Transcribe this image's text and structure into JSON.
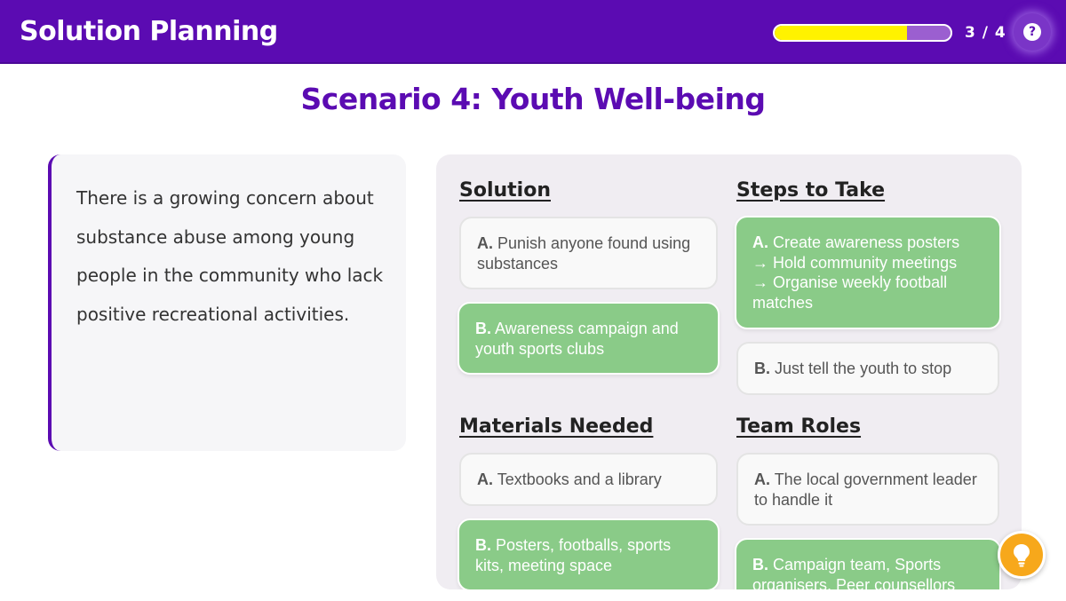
{
  "header": {
    "title": "Solution Planning",
    "progress_text": "3 / 4",
    "progress_fraction": 0.75,
    "help_icon": "question-icon",
    "accent_color": "#5b0bb2"
  },
  "scenario": {
    "title": "Scenario 4: Youth Well-being",
    "description": "There is a growing concern about substance abuse among young people in the community who lack positive recreational activities."
  },
  "sections": {
    "solution": {
      "title": "Solution",
      "options": [
        {
          "letter": "A.",
          "text": "Punish anyone found using substances",
          "selected": false
        },
        {
          "letter": "B.",
          "text": "Awareness campaign and youth sports clubs",
          "selected": true
        }
      ]
    },
    "steps": {
      "title": "Steps to Take",
      "options": [
        {
          "letter": "A.",
          "line1": "Create awareness posters",
          "line2": "→ Hold community meetings",
          "line3": "→ Organise weekly football matches",
          "selected": true
        },
        {
          "letter": "B.",
          "text": "Just tell the youth to stop",
          "selected": false
        }
      ]
    },
    "materials": {
      "title": "Materials Needed",
      "options": [
        {
          "letter": "A.",
          "text": "Textbooks and a library",
          "selected": false
        },
        {
          "letter": "B.",
          "text": "Posters, footballs, sports kits, meeting space",
          "selected": true
        }
      ]
    },
    "roles": {
      "title": "Team Roles",
      "options": [
        {
          "letter": "A.",
          "text": "The local government leader to handle it",
          "selected": false
        },
        {
          "letter": "B.",
          "text": "Campaign team, Sports organisers, Peer counsellors",
          "selected": true
        }
      ]
    }
  },
  "hint": {
    "icon": "lightbulb-icon",
    "color": "#f7a81b"
  },
  "colors": {
    "selected": "#8acb88",
    "unselected": "#f9f9f9",
    "progress": "#fff200"
  }
}
